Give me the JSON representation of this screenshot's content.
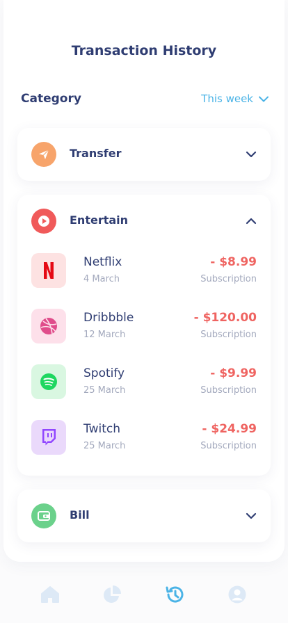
{
  "header": {
    "title": "Transaction History"
  },
  "filter": {
    "label": "Category",
    "period": "This week"
  },
  "categories": [
    {
      "label": "Transfer",
      "icon": "paper-plane-icon",
      "color": "#f7a46b",
      "expanded": false
    },
    {
      "label": "Entertain",
      "icon": "play-icon",
      "color": "#f05a5a",
      "expanded": true
    },
    {
      "label": "Bill",
      "icon": "wallet-icon",
      "color": "#6bd18b",
      "expanded": false
    }
  ],
  "transactions": [
    {
      "name": "Netflix",
      "date": "4 March",
      "amount": "- $8.99",
      "type": "Subscription",
      "icon": "netflix-icon",
      "bg": "#fde2e2"
    },
    {
      "name": "Dribbble",
      "date": "12 March",
      "amount": "- $120.00",
      "type": "Subscription",
      "icon": "dribbble-icon",
      "bg": "#fde0ea"
    },
    {
      "name": "Spotify",
      "date": "25 March",
      "amount": "- $9.99",
      "type": "Subscription",
      "icon": "spotify-icon",
      "bg": "#d9f7e1"
    },
    {
      "name": "Twitch",
      "date": "25 March",
      "amount": "- $24.99",
      "type": "Subscription",
      "icon": "twitch-icon",
      "bg": "#ead9fb"
    }
  ],
  "tabbar": {
    "tabs": [
      {
        "icon": "home-icon",
        "active": false
      },
      {
        "icon": "pie-chart-icon",
        "active": false
      },
      {
        "icon": "history-icon",
        "active": true
      },
      {
        "icon": "profile-icon",
        "active": false
      }
    ]
  },
  "colors": {
    "accent": "#4ab3e6",
    "negative": "#ef6461",
    "text": "#2f3d72",
    "muted": "#a3a9bd",
    "tab_inactive": "#dde9f6"
  }
}
